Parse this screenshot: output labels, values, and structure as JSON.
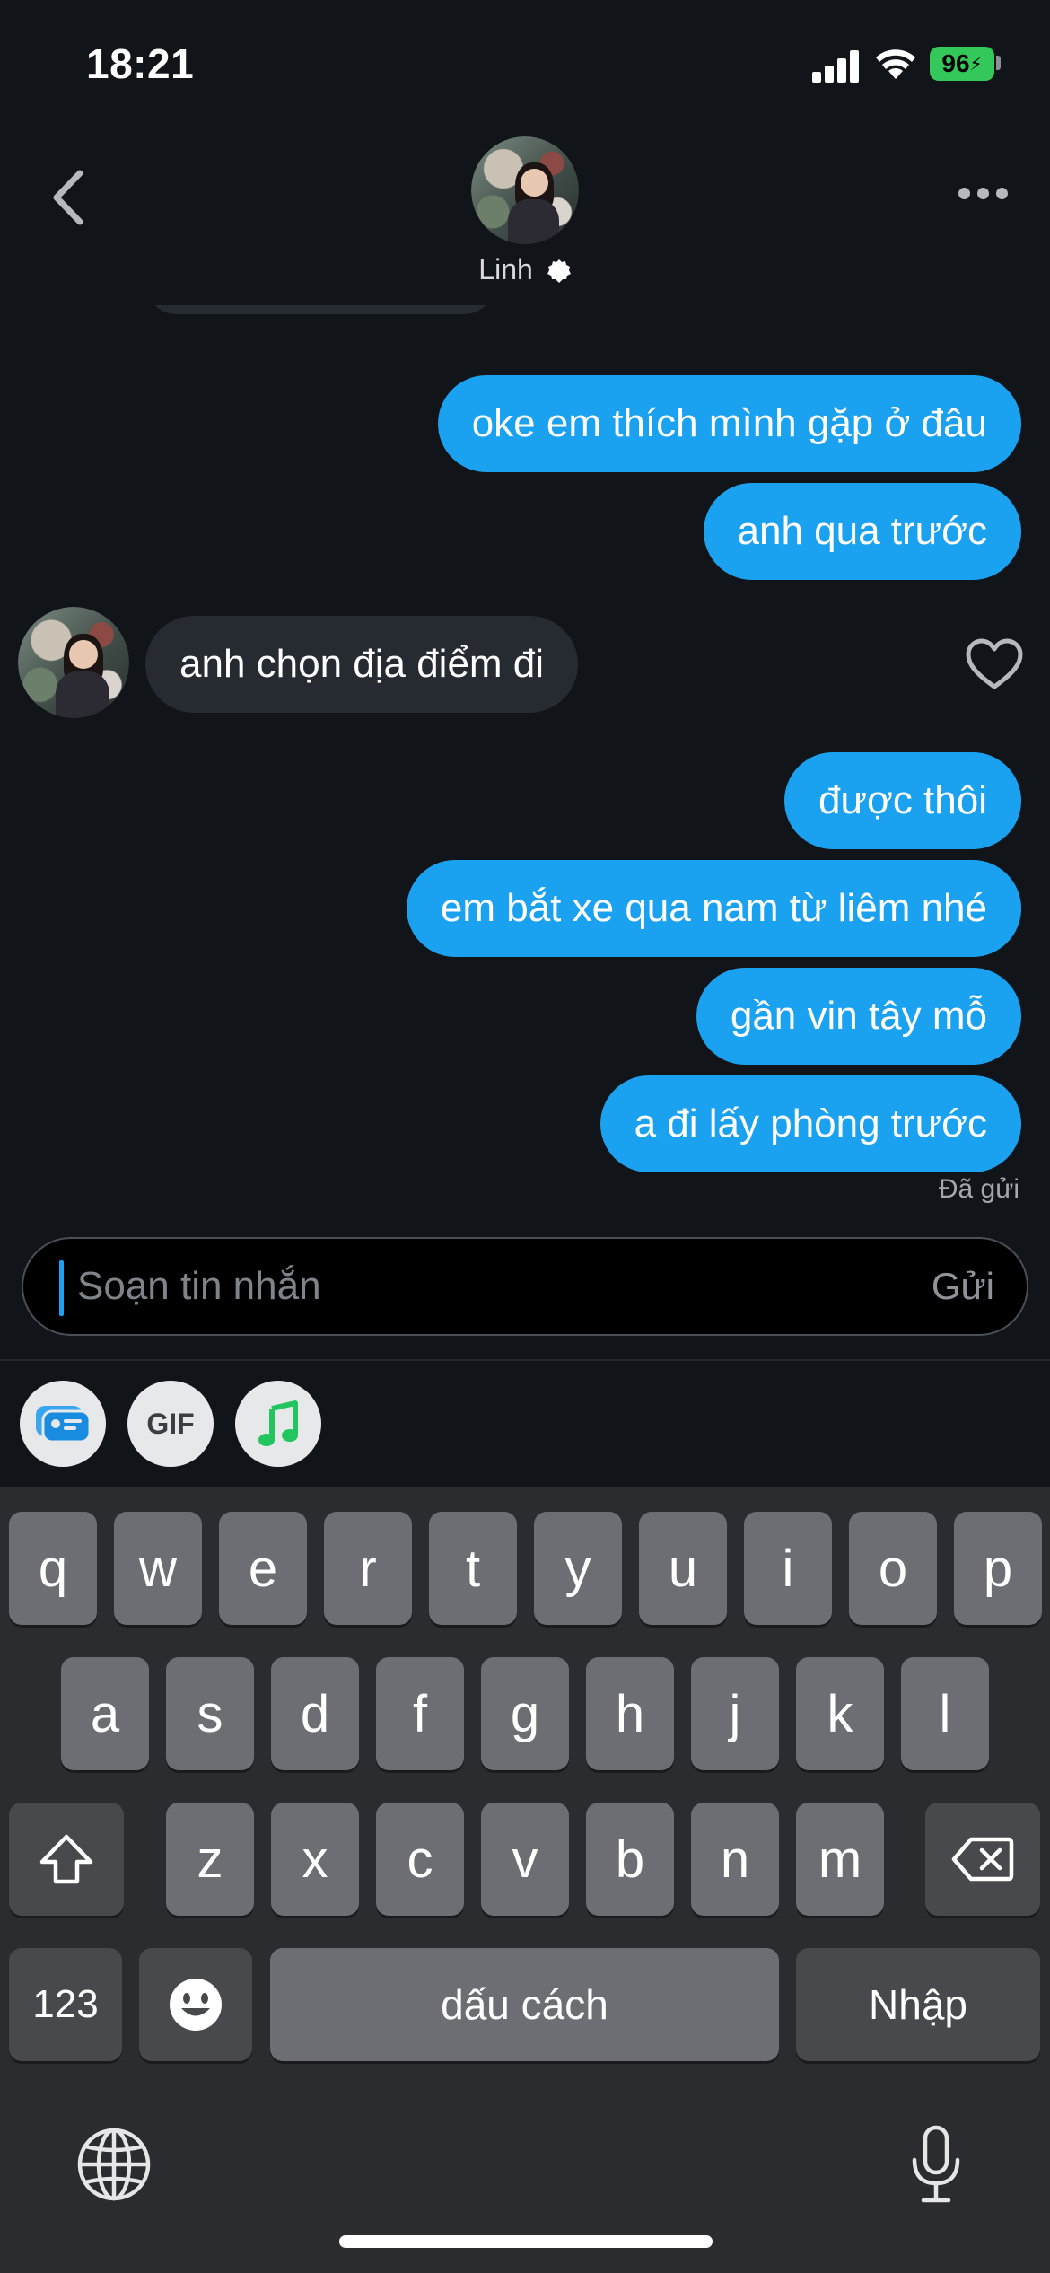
{
  "status_bar": {
    "time": "18:21",
    "battery": "96"
  },
  "header": {
    "contact_name": "Linh"
  },
  "messages": [
    {
      "direction": "out",
      "text": "oke em thích mình gặp ở đâu"
    },
    {
      "direction": "out",
      "text": "anh qua trước"
    },
    {
      "direction": "in",
      "text": "anh chọn địa điểm đi"
    },
    {
      "direction": "out",
      "text": "được thôi"
    },
    {
      "direction": "out",
      "text": "em bắt xe qua nam từ liêm nhé"
    },
    {
      "direction": "out",
      "text": "gần vin tây mỗ"
    },
    {
      "direction": "out",
      "text": "a đi lấy phòng trước"
    }
  ],
  "sent_status": "Đã gửi",
  "composer": {
    "placeholder": "Soạn tin nhắn",
    "send_label": "Gửi"
  },
  "attachments": {
    "gif_label": "GIF"
  },
  "keyboard": {
    "row1": [
      "q",
      "w",
      "e",
      "r",
      "t",
      "y",
      "u",
      "i",
      "o",
      "p"
    ],
    "row2": [
      "a",
      "s",
      "d",
      "f",
      "g",
      "h",
      "j",
      "k",
      "l"
    ],
    "row3": [
      "z",
      "x",
      "c",
      "v",
      "b",
      "n",
      "m"
    ],
    "numbers_label": "123",
    "space_label": "dấu cách",
    "return_label": "Nhập"
  },
  "colors": {
    "outgoing_bubble": "#1aa1f0",
    "incoming_bubble": "#262a31",
    "background": "#111418",
    "battery": "#34c759"
  }
}
